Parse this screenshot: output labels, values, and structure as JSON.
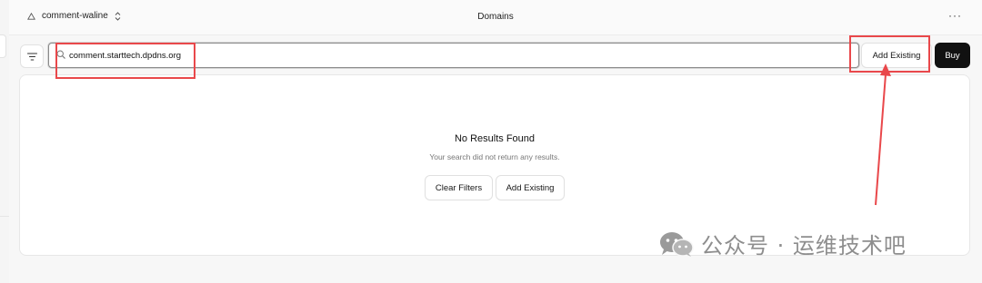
{
  "topbar": {
    "project_name": "comment-waline",
    "title": "Domains",
    "more_label": "···"
  },
  "toolbar": {
    "search_value": "comment.starttech.dpdns.org",
    "add_existing_label": "Add Existing",
    "buy_label": "Buy"
  },
  "empty_state": {
    "title": "No Results Found",
    "description": "Your search did not return any results.",
    "clear_filters_label": "Clear Filters",
    "add_existing_label": "Add Existing"
  },
  "watermark": {
    "text": "公众号 · 运维技术吧"
  },
  "colors": {
    "annotation": "#e9484b",
    "primary_button": "#111111",
    "background": "#f7f7f7"
  }
}
